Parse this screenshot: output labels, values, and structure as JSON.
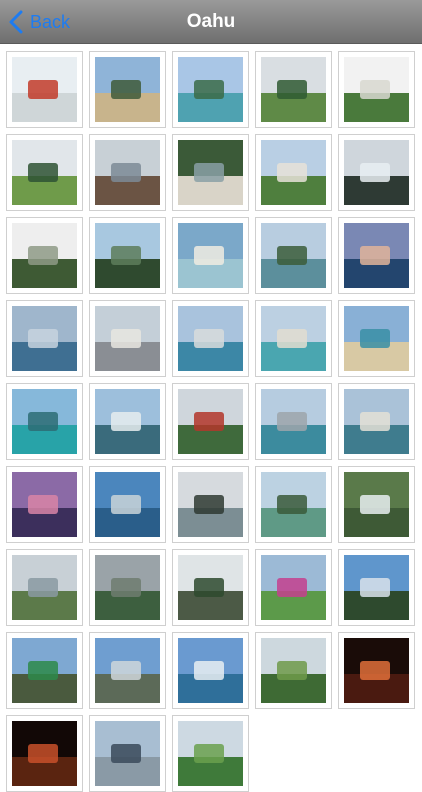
{
  "nav": {
    "back_label": "Back",
    "title": "Oahu",
    "tint_color": "#1d7cf2"
  },
  "photos": [
    {
      "name": "photo-red-pavilion",
      "sky": "#e8eef2",
      "ground": "#cfd6d8",
      "accent": "#c23b2a"
    },
    {
      "name": "photo-sandy-beach-trees",
      "sky": "#8fb4d8",
      "ground": "#c8b48c",
      "accent": "#3f5a3a"
    },
    {
      "name": "photo-beach-lagoon",
      "sky": "#a9c6e6",
      "ground": "#4fa2b1",
      "accent": "#3b6b48"
    },
    {
      "name": "photo-green-valley",
      "sky": "#d9dee2",
      "ground": "#5f8a47",
      "accent": "#2f5a33"
    },
    {
      "name": "photo-white-house-palms",
      "sky": "#f2f2f2",
      "ground": "#4a7a3c",
      "accent": "#d8d8d0"
    },
    {
      "name": "photo-tree-mountain",
      "sky": "#e1e6ea",
      "ground": "#6f9b4a",
      "accent": "#2e5234"
    },
    {
      "name": "photo-rocky-shore",
      "sky": "#c8d0d6",
      "ground": "#6b5444",
      "accent": "#7c8b96"
    },
    {
      "name": "photo-stairway-garden",
      "sky": "#3b5a38",
      "ground": "#d9d4c8",
      "accent": "#8aa0a6"
    },
    {
      "name": "photo-house-gardens",
      "sky": "#b9cfe4",
      "ground": "#4f7f3e",
      "accent": "#e6e2d8"
    },
    {
      "name": "photo-waves-cliff",
      "sky": "#cfd6dc",
      "ground": "#2e3a34",
      "accent": "#e8eef2"
    },
    {
      "name": "photo-foggy-field",
      "sky": "#eeeeee",
      "ground": "#3e5a34",
      "accent": "#8e9a86"
    },
    {
      "name": "photo-bare-tree-coast",
      "sky": "#a8c8e0",
      "ground": "#2f4a2f",
      "accent": "#5d7c5a"
    },
    {
      "name": "photo-villa-pool",
      "sky": "#7ba8c9",
      "ground": "#9bc4d1",
      "accent": "#f0ece2"
    },
    {
      "name": "photo-bay-beach",
      "sky": "#b8cde0",
      "ground": "#5c8f9c",
      "accent": "#3b5d3a"
    },
    {
      "name": "photo-dusk-ocean",
      "sky": "#7a88b4",
      "ground": "#23456e",
      "accent": "#e0b49a"
    },
    {
      "name": "photo-misty-sea",
      "sky": "#9fb6cc",
      "ground": "#3f6f92",
      "accent": "#c7d4de"
    },
    {
      "name": "photo-highrise-towers",
      "sky": "#c4cfd8",
      "ground": "#8a8e94",
      "accent": "#e8e6e0"
    },
    {
      "name": "photo-city-skyline-water",
      "sky": "#a9c3dd",
      "ground": "#3c87a6",
      "accent": "#d8dcdc"
    },
    {
      "name": "photo-waikiki-shore",
      "sky": "#bcd0e2",
      "ground": "#4aa6b0",
      "accent": "#e2ddd0"
    },
    {
      "name": "photo-hotel-beach",
      "sky": "#89b0d6",
      "ground": "#d8c9a4",
      "accent": "#3a8fa6"
    },
    {
      "name": "photo-turquoise-water",
      "sky": "#86b8da",
      "ground": "#28a3a8",
      "accent": "#2d6c74"
    },
    {
      "name": "photo-reef-waves",
      "sky": "#9dbfdc",
      "ground": "#3a6b7c",
      "accent": "#e6ecee"
    },
    {
      "name": "photo-byodo-temple",
      "sky": "#cfd6dc",
      "ground": "#3f6a3c",
      "accent": "#b3362a"
    },
    {
      "name": "photo-harbor-towers",
      "sky": "#b6cce0",
      "ground": "#3c8b9e",
      "accent": "#9da4aa"
    },
    {
      "name": "photo-beach-skyline",
      "sky": "#aac2d8",
      "ground": "#3f7c8e",
      "accent": "#e4e0d6"
    },
    {
      "name": "photo-palm-sunset",
      "sky": "#8b6aa6",
      "ground": "#3c2f5c",
      "accent": "#d884a6"
    },
    {
      "name": "photo-aerial-coast",
      "sky": "#4b86bd",
      "ground": "#2a5e8a",
      "accent": "#c9d3d8"
    },
    {
      "name": "photo-palms-overcast",
      "sky": "#d6dade",
      "ground": "#7c8e94",
      "accent": "#2f3a32"
    },
    {
      "name": "photo-mokolii-island",
      "sky": "#bcd2e2",
      "ground": "#5f9a86",
      "accent": "#3a5a3a"
    },
    {
      "name": "photo-waterfall",
      "sky": "#5a7a4a",
      "ground": "#3e5a36",
      "accent": "#e8eef0"
    },
    {
      "name": "photo-valley-town",
      "sky": "#c8d0d6",
      "ground": "#5c7a4a",
      "accent": "#8a9aa2"
    },
    {
      "name": "photo-cloudy-ridge",
      "sky": "#9aa3a8",
      "ground": "#3d5f3f",
      "accent": "#6e7c70"
    },
    {
      "name": "photo-highway-trees",
      "sky": "#dfe4e6",
      "ground": "#4c5a46",
      "accent": "#2e4a2e"
    },
    {
      "name": "photo-cultural-dancers",
      "sky": "#9cbad6",
      "ground": "#5c9a4a",
      "accent": "#c43f8e"
    },
    {
      "name": "photo-palms-blue-sky",
      "sky": "#5f96cc",
      "ground": "#2e4a2e",
      "accent": "#d8e2ea"
    },
    {
      "name": "photo-road-sign",
      "sky": "#7ea8d2",
      "ground": "#4a5a3e",
      "accent": "#2d8a4a"
    },
    {
      "name": "photo-open-road",
      "sky": "#6f9ed0",
      "ground": "#5c6a58",
      "accent": "#cfd6da"
    },
    {
      "name": "photo-coastal-clouds",
      "sky": "#6a9ad0",
      "ground": "#2f6f9a",
      "accent": "#e8eef2"
    },
    {
      "name": "photo-jungle-tree",
      "sky": "#cdd8de",
      "ground": "#3e6a34",
      "accent": "#6f9a4a"
    },
    {
      "name": "photo-luau-show",
      "sky": "#1a0c08",
      "ground": "#4a1a10",
      "accent": "#e0703a"
    },
    {
      "name": "photo-torch-night",
      "sky": "#120806",
      "ground": "#5a2410",
      "accent": "#c8502a"
    },
    {
      "name": "photo-ship-mast",
      "sky": "#a8bed2",
      "ground": "#8a9aa6",
      "accent": "#3a4a5a"
    },
    {
      "name": "photo-palm-fronds",
      "sky": "#cdd9e2",
      "ground": "#3f7a3a",
      "accent": "#6aa04e"
    }
  ]
}
